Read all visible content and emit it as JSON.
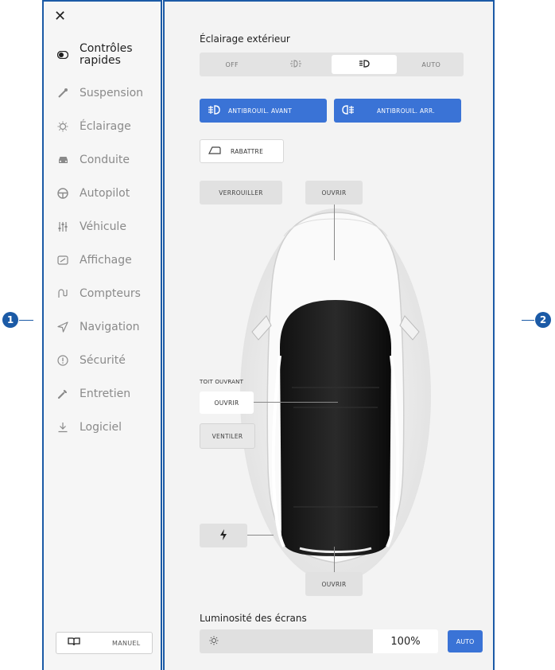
{
  "callouts": {
    "left": "1",
    "right": "2"
  },
  "sidebar": {
    "close_icon": "✕",
    "items": [
      {
        "label": "Contrôles rapides",
        "icon": "toggle-icon",
        "active": true
      },
      {
        "label": "Suspension",
        "icon": "suspension-icon"
      },
      {
        "label": "Éclairage",
        "icon": "light-bulb-icon"
      },
      {
        "label": "Conduite",
        "icon": "car-icon"
      },
      {
        "label": "Autopilot",
        "icon": "steering-wheel-icon"
      },
      {
        "label": "Véhicule",
        "icon": "sliders-icon"
      },
      {
        "label": "Affichage",
        "icon": "display-icon"
      },
      {
        "label": "Compteurs",
        "icon": "gauge-icon"
      },
      {
        "label": "Navigation",
        "icon": "navigation-icon"
      },
      {
        "label": "Sécurité",
        "icon": "alert-icon"
      },
      {
        "label": "Entretien",
        "icon": "wrench-icon"
      },
      {
        "label": "Logiciel",
        "icon": "download-icon"
      }
    ],
    "manual_label": "MANUEL"
  },
  "main": {
    "exterior_lighting_title": "Éclairage extérieur",
    "lighting_modes": [
      {
        "label": "OFF"
      },
      {
        "label": "parking-lights-icon",
        "is_icon": true
      },
      {
        "label": "low-beam-icon",
        "is_icon": true,
        "active": true
      },
      {
        "label": "AUTO"
      }
    ],
    "fog_front_label": "ANTIBROUIL. AVANT",
    "fog_rear_label": "ANTIBROUIL. ARR.",
    "fold_mirrors_label": "RABATTRE",
    "lock_label": "VERROUILLER",
    "frunk_open_label": "OUVRIR",
    "sunroof_title": "TOIT OUVRANT",
    "sunroof_open_label": "OUVRIR",
    "sunroof_vent_label": "VENTILER",
    "trunk_open_label": "OUVRIR",
    "brightness_title": "Luminosité des écrans",
    "brightness_value": "100%",
    "brightness_auto_label": "AUTO",
    "accent_color": "#3a73d6"
  }
}
